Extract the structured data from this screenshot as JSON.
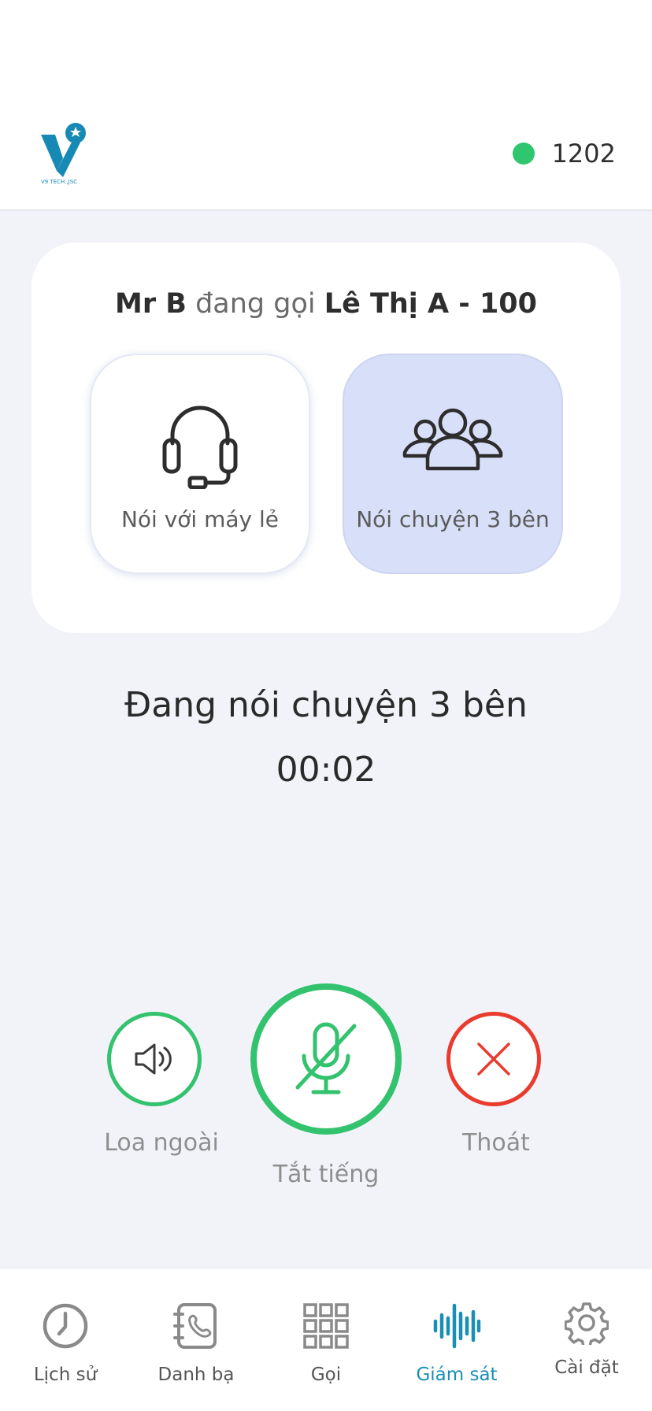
{
  "header": {
    "logo_text": "V9 TECH.,JSC",
    "status_color": "#2fc66f",
    "extension": "1202"
  },
  "call": {
    "caller": "Mr B",
    "action": "đang gọi",
    "callee": "Lê Thị A - 100"
  },
  "options": [
    {
      "label": "Nói với máy lẻ",
      "icon": "headset-icon",
      "selected": false
    },
    {
      "label": "Nói chuyện 3 bên",
      "icon": "group-icon",
      "selected": true
    }
  ],
  "status": {
    "state": "Đang nói chuyện 3 bên",
    "timer": "00:02"
  },
  "controls": {
    "speaker": {
      "label": "Loa ngoài",
      "icon": "speaker-icon",
      "color": "#33c26d"
    },
    "mute": {
      "label": "Tắt tiếng",
      "icon": "mic-off-icon",
      "color": "#33c26d"
    },
    "exit": {
      "label": "Thoát",
      "icon": "close-icon",
      "color": "#ea3b2f"
    }
  },
  "tabs": [
    {
      "label": "Lịch sử",
      "icon": "clock-icon",
      "active": false
    },
    {
      "label": "Danh bạ",
      "icon": "contacts-book-icon",
      "active": false
    },
    {
      "label": "Gọi",
      "icon": "dialpad-icon",
      "active": false
    },
    {
      "label": "Giám sát",
      "icon": "waveform-icon",
      "active": true
    },
    {
      "label": "Cài đặt",
      "icon": "gear-icon",
      "active": false
    }
  ],
  "colors": {
    "accent": "#1a8fb5",
    "background": "#f2f3f8",
    "selected_option": "#d7e0f8"
  }
}
